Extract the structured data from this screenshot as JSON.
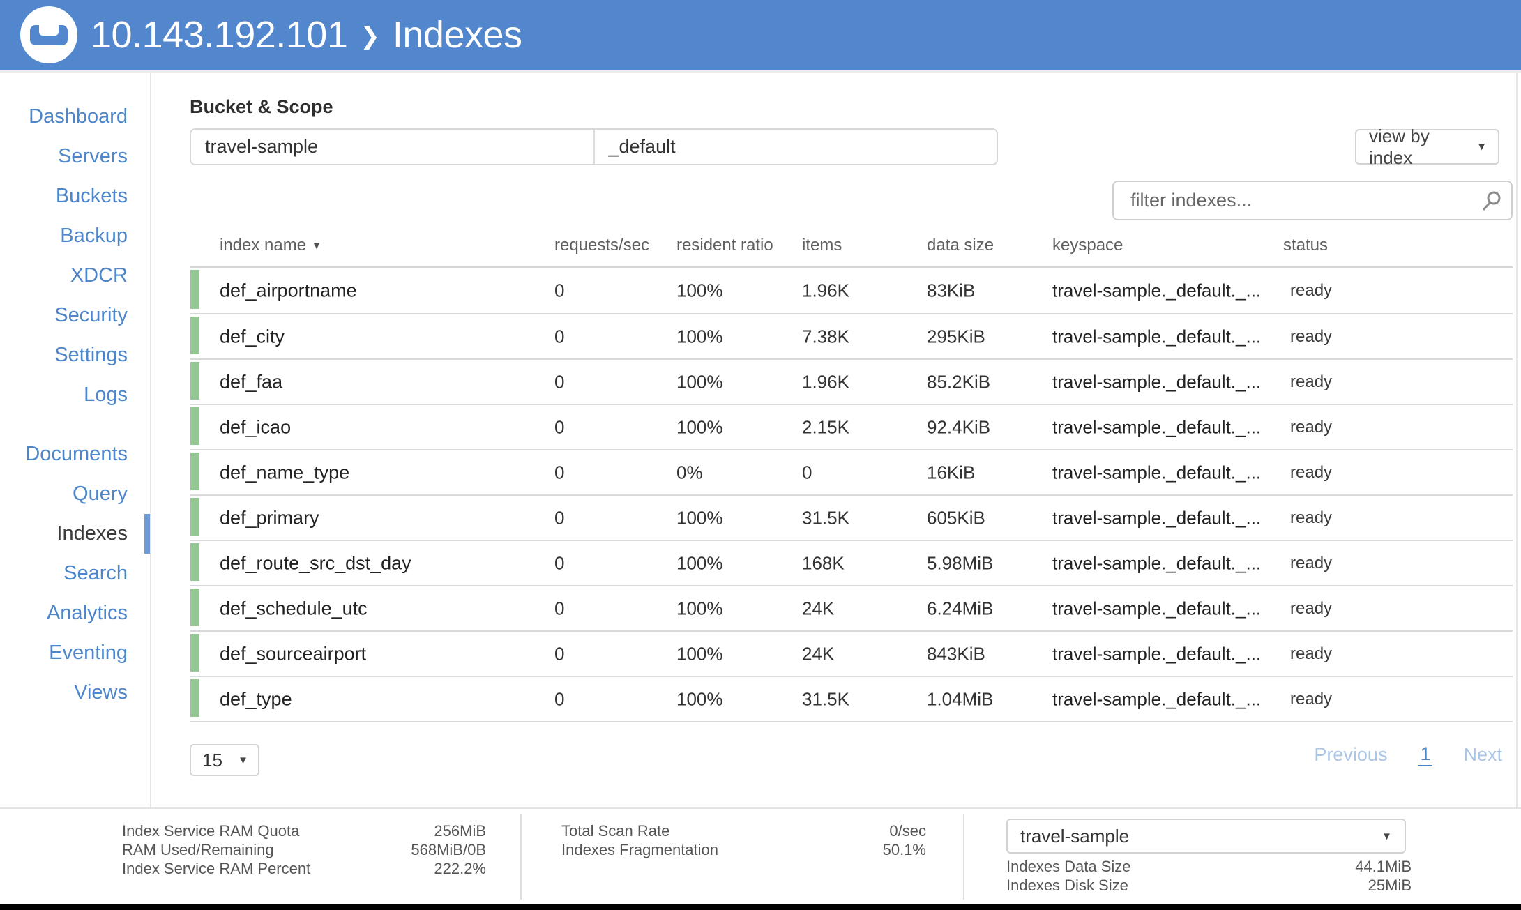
{
  "header": {
    "cluster": "10.143.192.101",
    "separator": "❯",
    "page": "Indexes"
  },
  "sidebar": {
    "items": [
      {
        "label": "Dashboard"
      },
      {
        "label": "Servers"
      },
      {
        "label": "Buckets"
      },
      {
        "label": "Backup"
      },
      {
        "label": "XDCR"
      },
      {
        "label": "Security"
      },
      {
        "label": "Settings"
      },
      {
        "label": "Logs"
      },
      {
        "label": "Documents",
        "gap_before": true
      },
      {
        "label": "Query"
      },
      {
        "label": "Indexes",
        "selected": true
      },
      {
        "label": "Search"
      },
      {
        "label": "Analytics"
      },
      {
        "label": "Eventing"
      },
      {
        "label": "Views"
      }
    ]
  },
  "toolbar": {
    "section_label": "Bucket & Scope",
    "bucket": "travel-sample",
    "scope": "_default",
    "view_by": "view by index",
    "filter_placeholder": "filter indexes..."
  },
  "icons": {
    "sort_desc": "▼",
    "dropdown": "▼"
  },
  "table": {
    "columns": [
      "index name",
      "requests/sec",
      "resident ratio",
      "items",
      "data size",
      "keyspace",
      "status"
    ],
    "rows": [
      {
        "name": "def_airportname",
        "requests": "0",
        "ratio": "100%",
        "items": "1.96K",
        "size": "83KiB",
        "keyspace": "travel-sample._default._...",
        "status": "ready"
      },
      {
        "name": "def_city",
        "requests": "0",
        "ratio": "100%",
        "items": "7.38K",
        "size": "295KiB",
        "keyspace": "travel-sample._default._...",
        "status": "ready"
      },
      {
        "name": "def_faa",
        "requests": "0",
        "ratio": "100%",
        "items": "1.96K",
        "size": "85.2KiB",
        "keyspace": "travel-sample._default._...",
        "status": "ready"
      },
      {
        "name": "def_icao",
        "requests": "0",
        "ratio": "100%",
        "items": "2.15K",
        "size": "92.4KiB",
        "keyspace": "travel-sample._default._...",
        "status": "ready"
      },
      {
        "name": "def_name_type",
        "requests": "0",
        "ratio": "0%",
        "items": "0",
        "size": "16KiB",
        "keyspace": "travel-sample._default._...",
        "status": "ready"
      },
      {
        "name": "def_primary",
        "requests": "0",
        "ratio": "100%",
        "items": "31.5K",
        "size": "605KiB",
        "keyspace": "travel-sample._default._...",
        "status": "ready"
      },
      {
        "name": "def_route_src_dst_day",
        "requests": "0",
        "ratio": "100%",
        "items": "168K",
        "size": "5.98MiB",
        "keyspace": "travel-sample._default._...",
        "status": "ready"
      },
      {
        "name": "def_schedule_utc",
        "requests": "0",
        "ratio": "100%",
        "items": "24K",
        "size": "6.24MiB",
        "keyspace": "travel-sample._default._...",
        "status": "ready"
      },
      {
        "name": "def_sourceairport",
        "requests": "0",
        "ratio": "100%",
        "items": "24K",
        "size": "843KiB",
        "keyspace": "travel-sample._default._...",
        "status": "ready"
      },
      {
        "name": "def_type",
        "requests": "0",
        "ratio": "100%",
        "items": "31.5K",
        "size": "1.04MiB",
        "keyspace": "travel-sample._default._...",
        "status": "ready"
      }
    ]
  },
  "pagination": {
    "page_size": "15",
    "previous": "Previous",
    "current_page": "1",
    "next": "Next"
  },
  "footer": {
    "left": [
      {
        "label": "Index Service RAM Quota",
        "value": "256MiB"
      },
      {
        "label": "RAM Used/Remaining",
        "value": "568MiB/0B"
      },
      {
        "label": "Index Service RAM Percent",
        "value": "222.2%"
      }
    ],
    "middle": [
      {
        "label": "Total Scan Rate",
        "value": "0/sec"
      },
      {
        "label": "Indexes Fragmentation",
        "value": "50.1%"
      }
    ],
    "bucket_select": "travel-sample",
    "right": [
      {
        "label": "Indexes Data Size",
        "value": "44.1MiB"
      },
      {
        "label": "Indexes Disk Size",
        "value": "25MiB"
      }
    ]
  },
  "colors": {
    "header_blue": "#5286cd",
    "link_blue": "#4e86cb",
    "selected_bar_blue": "#6d9bd8",
    "row_status_green": "#95c795",
    "pager_disabled": "#a9c5e8",
    "black_bar": "#000000"
  }
}
